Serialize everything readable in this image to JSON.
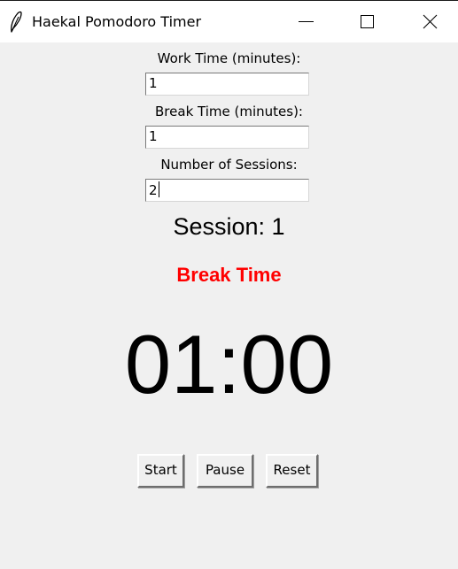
{
  "window": {
    "title": "Haekal Pomodoro Timer",
    "app_icon": "feather-icon",
    "controls": [
      "minimize-icon",
      "maximize-icon",
      "close-icon"
    ]
  },
  "form": {
    "work_label": "Work Time (minutes):",
    "work_value": "1",
    "break_label": "Break Time (minutes):",
    "break_value": "1",
    "sessions_label": "Number of Sessions:",
    "sessions_value": "2"
  },
  "status": {
    "session_text": "Session: 1",
    "phase_text": "Break Time",
    "phase_color": "#ff0000",
    "timer_text": "01:00"
  },
  "buttons": {
    "start": "Start",
    "pause": "Pause",
    "reset": "Reset"
  }
}
